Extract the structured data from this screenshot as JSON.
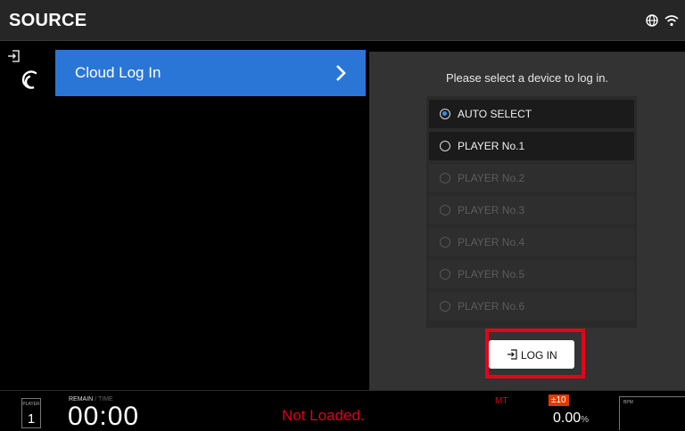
{
  "header": {
    "title": "SOURCE",
    "icons": [
      "globe-icon",
      "wifi-icon"
    ]
  },
  "sources": {
    "items": [
      {
        "label": "Cloud Log In",
        "icon": "cloud-logo-icon",
        "selected": true
      }
    ]
  },
  "login_panel": {
    "prompt": "Please select a device to log in.",
    "options": [
      {
        "label": "AUTO SELECT",
        "checked": true,
        "enabled": true
      },
      {
        "label": "PLAYER No.1",
        "checked": false,
        "enabled": true
      },
      {
        "label": "PLAYER No.2",
        "checked": false,
        "enabled": false
      },
      {
        "label": "PLAYER No.3",
        "checked": false,
        "enabled": false
      },
      {
        "label": "PLAYER No.4",
        "checked": false,
        "enabled": false
      },
      {
        "label": "PLAYER No.5",
        "checked": false,
        "enabled": false
      },
      {
        "label": "PLAYER No.6",
        "checked": false,
        "enabled": false
      }
    ],
    "login_button": "LOG IN"
  },
  "status_bar": {
    "player_label": "PLAYER",
    "player_number": "1",
    "remain_label": "REMAIN",
    "separator": "/",
    "time_label": "TIME",
    "time_value": "00:00",
    "load_status": "Not Loaded.",
    "master_tempo": "MT",
    "tempo_range": "±10",
    "pitch_value": "0.00",
    "pitch_unit": "%",
    "bpm_label": "BPM"
  },
  "colors": {
    "accent_blue": "#2a76d6",
    "alert_red": "#e00016",
    "highlight_red": "#e8001a"
  }
}
